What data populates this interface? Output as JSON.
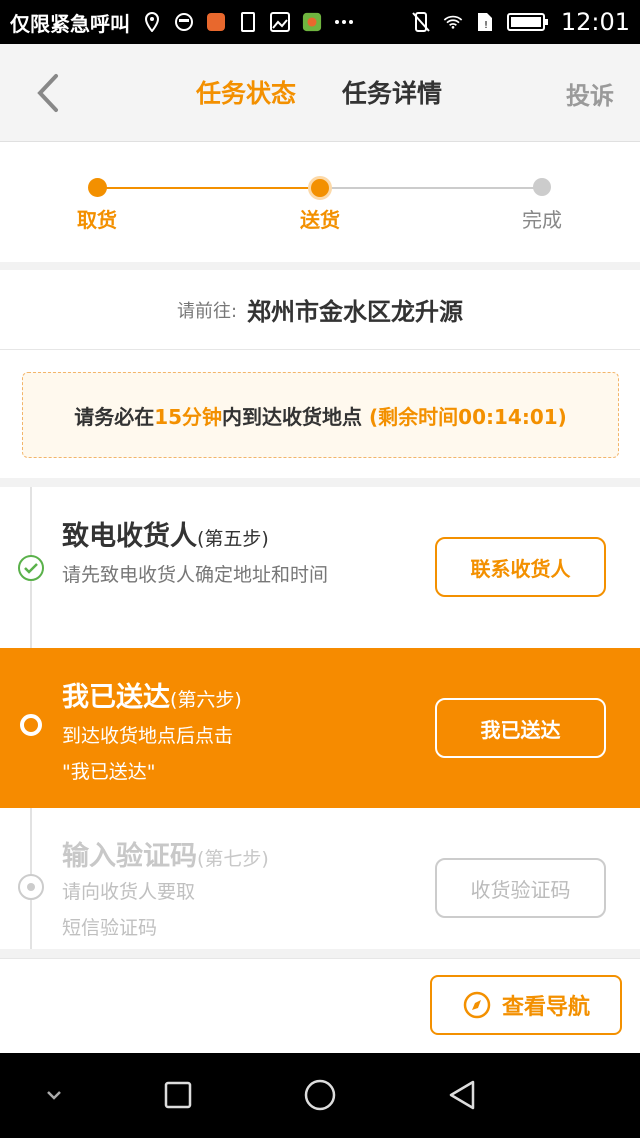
{
  "status_bar": {
    "carrier": "仅限紧急呼叫",
    "time": "12:01"
  },
  "header": {
    "tabs": [
      {
        "label": "任务状态",
        "active": true
      },
      {
        "label": "任务详情",
        "active": false
      }
    ],
    "complain_label": "投诉"
  },
  "progress": {
    "steps": [
      {
        "label": "取货",
        "state": "done"
      },
      {
        "label": "送货",
        "state": "current"
      },
      {
        "label": "完成",
        "state": "pending"
      }
    ]
  },
  "destination": {
    "label": "请前往:",
    "address": "郑州市金水区龙升源"
  },
  "notice": {
    "prefix": "请务必在",
    "highlight": "15分钟",
    "middle": "内到达收货地点",
    "remaining_label": "(剩余时间00:14:01)"
  },
  "steps": [
    {
      "title": "致电收货人",
      "sub": "(第五步)",
      "desc": [
        "请先致电收货人确定地址和时间"
      ],
      "button": "联系收货人",
      "state": "done"
    },
    {
      "title": "我已送达",
      "sub": "(第六步)",
      "desc": [
        "到达收货地点后点击",
        "\"我已送达\""
      ],
      "button": "我已送达",
      "state": "current"
    },
    {
      "title": "输入验证码",
      "sub": "(第七步)",
      "desc": [
        "请向收货人要取",
        "短信验证码"
      ],
      "button": "收货验证码",
      "state": "pending"
    }
  ],
  "bottom": {
    "navigate_label": "查看导航"
  },
  "colors": {
    "accent": "#f39000",
    "active_step_bg": "#f68b00",
    "done_check": "#5ab14a"
  }
}
